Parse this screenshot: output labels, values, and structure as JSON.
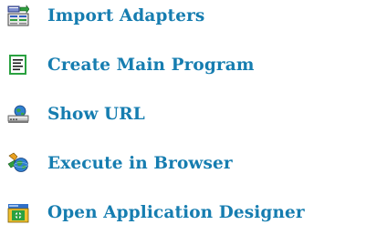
{
  "toolbar": {
    "items": [
      {
        "label": "Import Adapters",
        "icon": "import-adapters-icon"
      },
      {
        "label": "Create Main Program",
        "icon": "main-program-document-icon"
      },
      {
        "label": "Show URL",
        "icon": "show-url-icon"
      },
      {
        "label": "Execute in Browser",
        "icon": "execute-in-browser-icon"
      },
      {
        "label": "Open Application Designer",
        "icon": "application-designer-icon"
      }
    ]
  },
  "colors": {
    "link_text": "#167db0"
  }
}
